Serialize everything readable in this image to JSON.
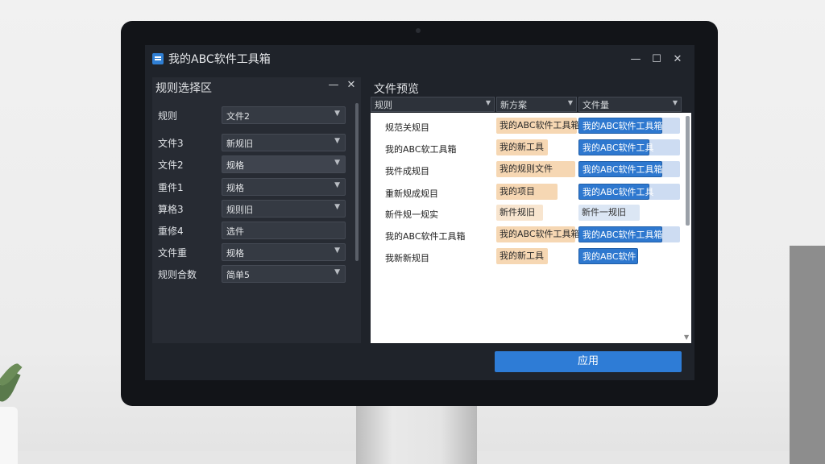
{
  "app": {
    "title": "我的ABC软件工具箱"
  },
  "window_controls": {
    "minimize": "—",
    "maximize": "☐",
    "close": "✕"
  },
  "left_panel": {
    "title": "规则选择区",
    "ctrl_min": "—",
    "ctrl_close": "✕",
    "rows": [
      {
        "label": "规则",
        "value": "文件2"
      },
      {
        "label": "文件3",
        "value": "新规旧"
      },
      {
        "label": "文件2",
        "value": "规格"
      },
      {
        "label": "重件1",
        "value": "规格"
      },
      {
        "label": "算格3",
        "value": "规则旧"
      },
      {
        "label": "重修4",
        "value": "选件"
      },
      {
        "label": "文件重",
        "value": "规格"
      },
      {
        "label": "规则合数",
        "value": "简单5"
      }
    ]
  },
  "right_panel": {
    "title": "文件预览",
    "headers": [
      "规则",
      "新方案",
      "文件量"
    ],
    "rows": [
      {
        "name": "规范关规目",
        "tag": "我的ABC软件工具箱",
        "target": "我的ABC软件工具箱",
        "target_style": "blue"
      },
      {
        "name": "我的ABC软工具箱",
        "tag": "我的新工具",
        "target": "我的ABC软件工具",
        "target_style": "blue"
      },
      {
        "name": "我件成规目",
        "tag": "我的规则文件",
        "target": "我的ABC软件工具箱",
        "target_style": "blue"
      },
      {
        "name": "重新规成规目",
        "tag": "我的项目",
        "target": "我的ABC软件工具",
        "target_style": "blue"
      },
      {
        "name": "新件规一规实",
        "tag": "新件规旧",
        "target": "新件一规旧",
        "target_style": "light"
      },
      {
        "name": "我的ABC软件工具箱",
        "tag": "我的ABC软件工具箱",
        "target": "我的ABC软件工具箱",
        "target_style": "blue"
      },
      {
        "name": "我新新规目",
        "tag": "我的新工具",
        "target": "我的ABC软件",
        "target_style": "blue"
      }
    ]
  },
  "apply_button": {
    "label": "应用"
  },
  "colors": {
    "accent": "#2e7cd6",
    "chip_orange": "#f6d7b3",
    "window_bg": "#1f232a"
  }
}
